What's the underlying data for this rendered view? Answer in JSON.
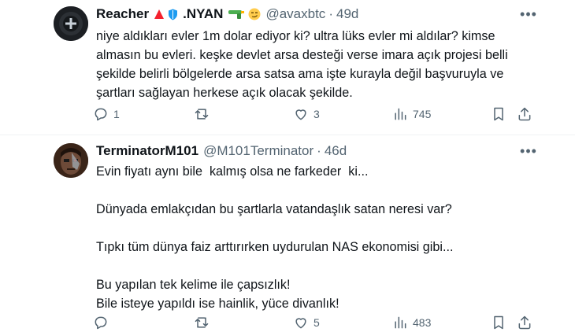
{
  "tweets": [
    {
      "display_name": "Reacher",
      "name_suffix": ".NYAN",
      "handle": "@avaxbtc",
      "time": "49d",
      "lines": [
        "niye aldıkları evler 1m dolar ediyor ki? ultra lüks evler mi aldılar? kimse",
        "almasın bu evleri. keşke devlet arsa desteği verse imara açık projesi belli",
        "şekilde belirli bölgelerde arsa satsa ama işte kurayla değil başvuruyla ve",
        "şartları sağlayan herkese açık olacak şekilde."
      ],
      "reply_count": "1",
      "retweet_count": "",
      "like_count": "3",
      "view_count": "745",
      "colors": {
        "triangle": "#f4212e",
        "shield": "#1d9bf0",
        "gun": "#4caf50",
        "emoji": "#ffcc4d"
      }
    },
    {
      "display_name": "TerminatorM101",
      "handle": "@M101Terminator",
      "time": "46d",
      "lines": [
        "Evin fiyatı aynı bile  kalmış olsa ne farkeder  ki...",
        "",
        "Dünyada emlakçıdan bu şartlarla vatandaşlık satan neresi var?",
        "",
        "Tıpkı tüm dünya faiz arttırırken uydurulan NAS ekonomisi gibi...",
        "",
        "Bu yapılan tek kelime ile çapsızlık!",
        "Bile isteye yapıldı ise hainlik, yüce divanlık!"
      ],
      "reply_count": "",
      "retweet_count": "",
      "like_count": "5",
      "view_count": "483"
    }
  ],
  "icons": [
    "reply-icon",
    "retweet-icon",
    "like-icon",
    "views-icon",
    "bookmark-icon",
    "share-icon",
    "more-icon"
  ],
  "theme": {
    "text": "#0f1419",
    "muted": "#536471",
    "divider": "#eff3f4"
  }
}
